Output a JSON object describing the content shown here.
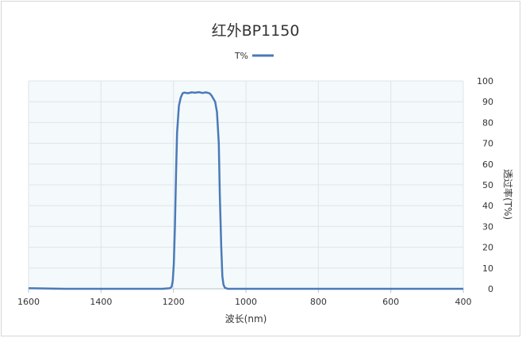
{
  "chart_data": {
    "type": "line",
    "title": "红外BP1150",
    "xlabel": "波长(nm)",
    "ylabel": "透过率(T%)",
    "legend": [
      "T%"
    ],
    "legend_position": "top-center",
    "x_axis_reversed": true,
    "y_axis_side": "right",
    "xlim": [
      400,
      1600
    ],
    "ylim": [
      0,
      100
    ],
    "x_ticks": [
      "400",
      "600",
      "800",
      "1000",
      "1200",
      "1400",
      "1600"
    ],
    "y_ticks": [
      "0",
      "10",
      "20",
      "30",
      "40",
      "50",
      "60",
      "70",
      "80",
      "90",
      "100"
    ],
    "grid": true,
    "colors": {
      "series": "#4a7ab8",
      "plot_background": "#f4f9fb",
      "grid": "#dde6ea"
    },
    "series": [
      {
        "name": "T%",
        "x": [
          400,
          500,
          600,
          700,
          800,
          900,
          1000,
          1030,
          1050,
          1058,
          1062,
          1065,
          1068,
          1072,
          1075,
          1080,
          1085,
          1095,
          1100,
          1110,
          1120,
          1130,
          1140,
          1150,
          1160,
          1170,
          1175,
          1180,
          1185,
          1190,
          1193,
          1196,
          1199,
          1202,
          1205,
          1210,
          1230,
          1300,
          1400,
          1500,
          1600
        ],
        "y": [
          0,
          0,
          0,
          0,
          0,
          0,
          0,
          0,
          0,
          0.5,
          2,
          6,
          20,
          45,
          70,
          85,
          90,
          93,
          94,
          94.5,
          94.2,
          94.6,
          94.3,
          94.5,
          94.1,
          94.4,
          94,
          92,
          88,
          75,
          55,
          30,
          12,
          4,
          1,
          0.3,
          0,
          0,
          0,
          0,
          0.3
        ]
      }
    ]
  }
}
